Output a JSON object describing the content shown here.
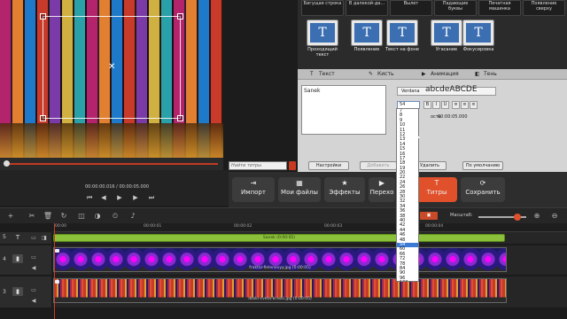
{
  "palette": {
    "top_row": [
      "Бегущая строка",
      "В далекой-да...",
      "Вылет",
      "Падающие буквы",
      "Печатная машинка",
      "Появление сверху"
    ],
    "styles": [
      {
        "label": "Проходящий текст",
        "glyph": "T"
      },
      {
        "label": "Появление",
        "glyph": "T"
      },
      {
        "label": "Текст на фоне",
        "glyph": "T"
      },
      {
        "label": "Угасание",
        "glyph": "T"
      },
      {
        "label": "Фокусировка",
        "glyph": "T"
      }
    ]
  },
  "properties": {
    "tabs": [
      {
        "label": "Текст",
        "icon": "text-icon"
      },
      {
        "label": "Кисть",
        "icon": "brush-icon"
      },
      {
        "label": "Анимация",
        "icon": "animation-icon"
      },
      {
        "label": "Тень",
        "icon": "shadow-icon"
      }
    ],
    "text_value": "Sanek",
    "font_name": "Verdana",
    "font_preview": "abcdeABCDE",
    "size_value": "54",
    "format_buttons": [
      "B",
      "I",
      "U",
      "≡",
      "≡",
      "≡"
    ],
    "duration_label": "ость",
    "duration_value": "00:00:05.000",
    "buttons": {
      "settings": "Настройки",
      "add": "Добавить",
      "delete": "Удалить",
      "default": "По умолчанию"
    }
  },
  "size_list": {
    "items": [
      "7",
      "8",
      "9",
      "10",
      "11",
      "12",
      "13",
      "14",
      "15",
      "16",
      "17",
      "18",
      "19",
      "20",
      "22",
      "24",
      "26",
      "28",
      "30",
      "32",
      "34",
      "36",
      "38",
      "40",
      "42",
      "44",
      "46",
      "48",
      "54",
      "60",
      "66",
      "72",
      "78",
      "84",
      "90",
      "96",
      "102",
      "108",
      "114",
      "120",
      "128"
    ],
    "selected": "54"
  },
  "search": {
    "placeholder": "Найти титры"
  },
  "transport": {
    "timecode": "00:00:00.016 / 00:00:05.000"
  },
  "toolbar": {
    "buttons": [
      {
        "label": "Импорт",
        "icon": "import-icon"
      },
      {
        "label": "Мои файлы",
        "icon": "files-icon"
      },
      {
        "label": "Эффекты",
        "icon": "effects-icon"
      },
      {
        "label": "Перехо",
        "icon": "transitions-icon"
      },
      {
        "label": "Титры",
        "icon": "titles-icon"
      },
      {
        "label": "Сохранить",
        "icon": "save-icon"
      }
    ]
  },
  "timeline": {
    "zoom_label": "Масштаб:",
    "ruler_ticks": [
      "00:00",
      "00:00:01",
      "00:00:02",
      "00:00:03",
      "00:00:04"
    ],
    "tracks": [
      {
        "number": "5",
        "clip_label": "Sanek (0:00:05)"
      },
      {
        "number": "4",
        "clip_label": "fraktal-fielenovyy.jpg (0:00:05)"
      },
      {
        "number": "3",
        "clip_label": "doski-cveta-kraski.jpg (0:00:05)"
      }
    ]
  },
  "colors": {
    "accent": "#e0502a",
    "title_clip": "#8ac03a",
    "selection": "#3a7ad6"
  }
}
